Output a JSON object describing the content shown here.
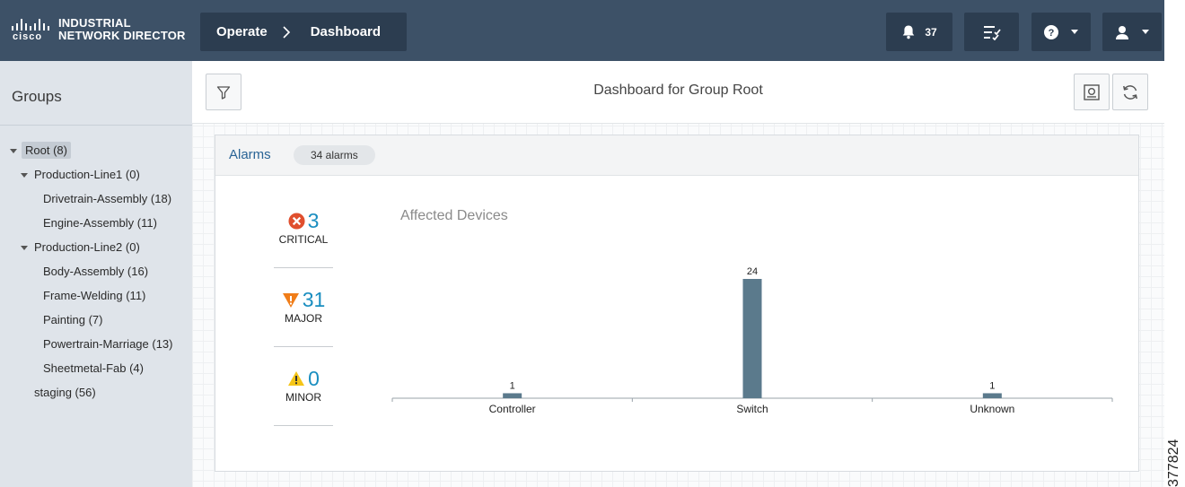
{
  "topbar": {
    "brand_word": "cisco",
    "brand_line1": "INDUSTRIAL",
    "brand_line2": "NETWORK DIRECTOR",
    "breadcrumb": [
      "Operate",
      "Dashboard"
    ],
    "notification_count": "37",
    "icons": [
      "bell-icon",
      "task-list-icon",
      "help-icon",
      "user-icon"
    ]
  },
  "sidebar": {
    "title": "Groups",
    "tree": [
      {
        "label": "Root (8)",
        "level": 0,
        "expanded": true,
        "selected": true
      },
      {
        "label": "Production-Line1 (0)",
        "level": 1,
        "expanded": true
      },
      {
        "label": "Drivetrain-Assembly (18)",
        "level": 2
      },
      {
        "label": "Engine-Assembly (11)",
        "level": 2
      },
      {
        "label": "Production-Line2 (0)",
        "level": 1,
        "expanded": true
      },
      {
        "label": "Body-Assembly (16)",
        "level": 2
      },
      {
        "label": "Frame-Welding (11)",
        "level": 2
      },
      {
        "label": "Painting (7)",
        "level": 2
      },
      {
        "label": "Powertrain-Marriage (13)",
        "level": 2
      },
      {
        "label": "Sheetmetal-Fab (4)",
        "level": 2
      },
      {
        "label": "staging (56)",
        "level": 1
      }
    ]
  },
  "main": {
    "title": "Dashboard for Group Root",
    "panel": {
      "title": "Alarms",
      "count_label": "34 alarms",
      "severities": [
        {
          "label": "CRITICAL",
          "count": "3",
          "color": "#e04f2e"
        },
        {
          "label": "MAJOR",
          "count": "31",
          "color": "#f07d19"
        },
        {
          "label": "MINOR",
          "count": "0",
          "color": "#f5c518"
        }
      ]
    }
  },
  "chart_data": {
    "type": "bar",
    "title": "Affected Devices",
    "categories": [
      "Controller",
      "Switch",
      "Unknown"
    ],
    "values": [
      1,
      24,
      1
    ],
    "ylim": [
      0,
      24
    ],
    "grid": false,
    "bar_color": "#5b7a8c"
  },
  "side_label": "377824",
  "colors": {
    "topbar": "#3d5167",
    "topbar_button": "#2c3d50",
    "accent_number": "#1a8ec0",
    "link": "#2a6496"
  }
}
